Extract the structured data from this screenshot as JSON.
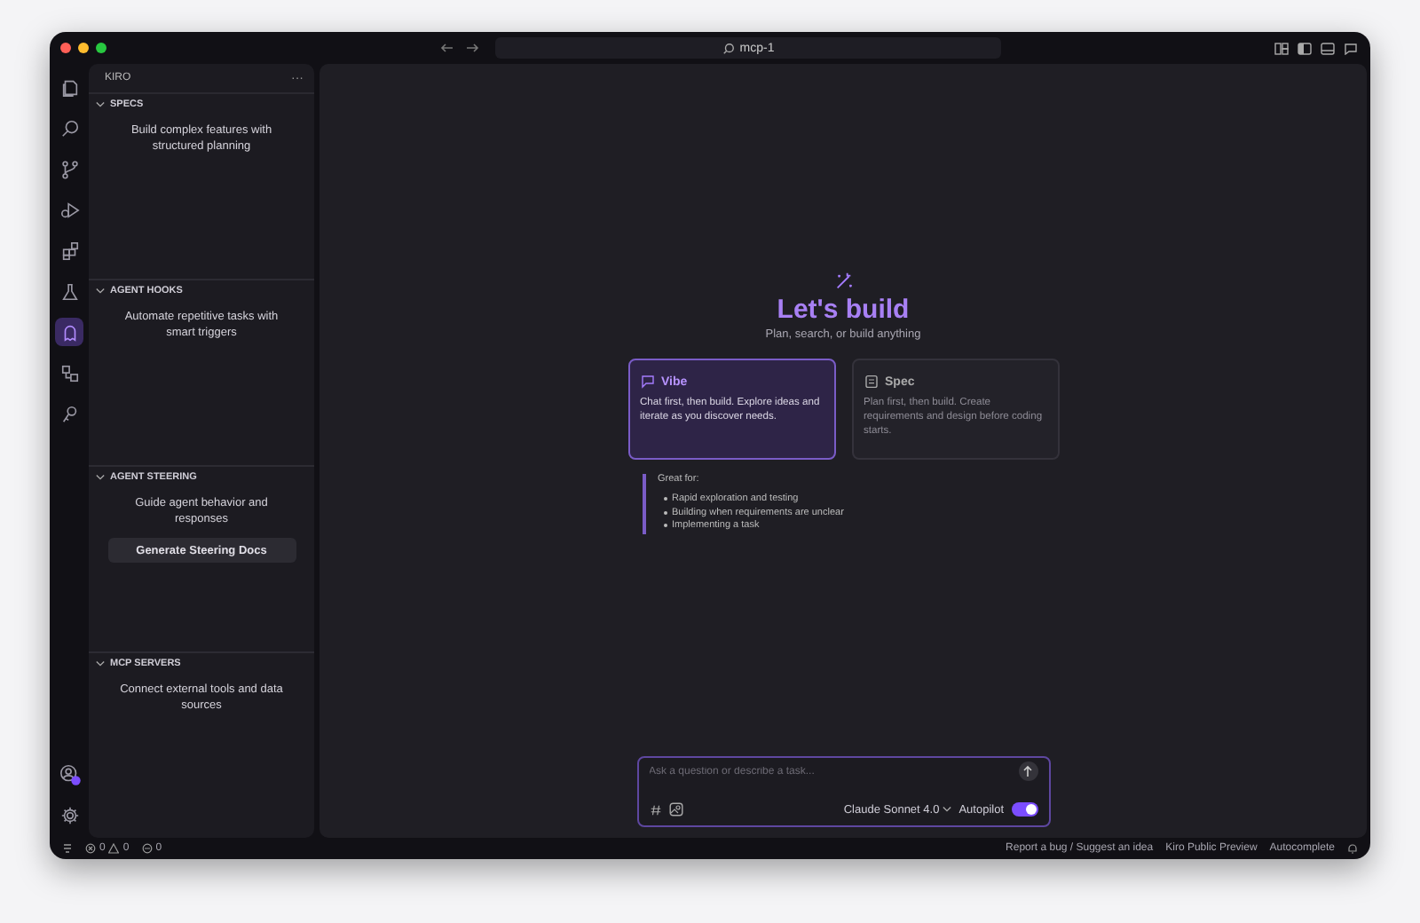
{
  "window": {
    "title": "mcp-1"
  },
  "activity_bar": {
    "items": [
      {
        "selected": false
      },
      {
        "selected": false
      },
      {
        "selected": false
      },
      {
        "selected": false
      },
      {
        "selected": false
      },
      {
        "selected": false
      },
      {
        "selected": true
      },
      {
        "selected": false
      },
      {
        "selected": false
      }
    ]
  },
  "sidebar": {
    "title": "KIRO",
    "more": "···",
    "sections": [
      {
        "title": "SPECS",
        "expanded": true,
        "description": "Build complex features with structured planning"
      },
      {
        "title": "AGENT HOOKS",
        "expanded": true,
        "description": "Automate repetitive tasks with smart triggers"
      },
      {
        "title": "AGENT STEERING",
        "expanded": true,
        "description": "Guide agent behavior and responses",
        "button": "Generate Steering Docs"
      },
      {
        "title": "MCP SERVERS",
        "expanded": true,
        "description": "Connect external tools and data sources"
      }
    ]
  },
  "main": {
    "heading": "Let's build",
    "subheading": "Plan, search, or build anything",
    "modes": [
      {
        "kind": "chat",
        "label": "Vibe",
        "description": "Chat first, then build. Explore ideas and iterate as you discover needs.",
        "selected": true
      },
      {
        "kind": "doc",
        "label": "Spec",
        "description": "Plan first, then build. Create requirements and design before coding starts.",
        "selected": false
      }
    ],
    "great_for": {
      "title": "Great for:",
      "items": [
        "Rapid exploration and testing",
        "Building when requirements are unclear",
        "Implementing a task"
      ]
    }
  },
  "chat": {
    "placeholder": "Ask a question or describe a task...",
    "model": "Claude Sonnet 4.0",
    "autopilot": {
      "label": "Autopilot",
      "on": true
    }
  },
  "status_bar": {
    "errors": "0",
    "warnings": "0",
    "ports": "0",
    "items": [
      "Report a bug / Suggest an idea",
      "Kiro Public Preview",
      "Autocomplete"
    ]
  }
}
